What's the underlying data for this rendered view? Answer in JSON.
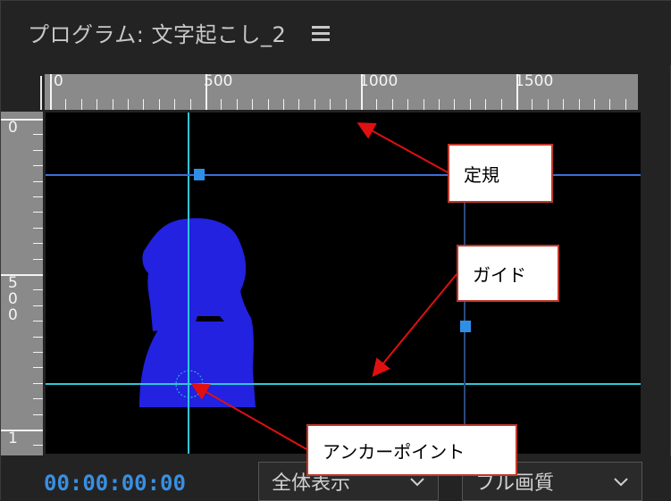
{
  "panel": {
    "title": "プログラム: 文字起こし_2",
    "menu_icon": "hamburger-menu-icon"
  },
  "ruler": {
    "horizontal_labels": [
      "0",
      "500",
      "1000",
      "1500"
    ],
    "vertical_labels": [
      "0",
      "5",
      "0",
      "0",
      "1"
    ]
  },
  "annotations": {
    "ruler_callout": "定規",
    "guide_callout": "ガイド",
    "anchor_callout": "アンカーポイント"
  },
  "colors": {
    "guide_cyan": "#2ec8d8",
    "guide_blue": "#3a6fd8",
    "handle_blue": "#2f8fe6",
    "silhouette": "#2222e0",
    "arrow_red": "#e01010",
    "timecode_blue": "#3a8fe0"
  },
  "footer": {
    "timecode": "00:00:00:00",
    "zoom_select": "全体表示",
    "quality_select": "フル画質"
  }
}
